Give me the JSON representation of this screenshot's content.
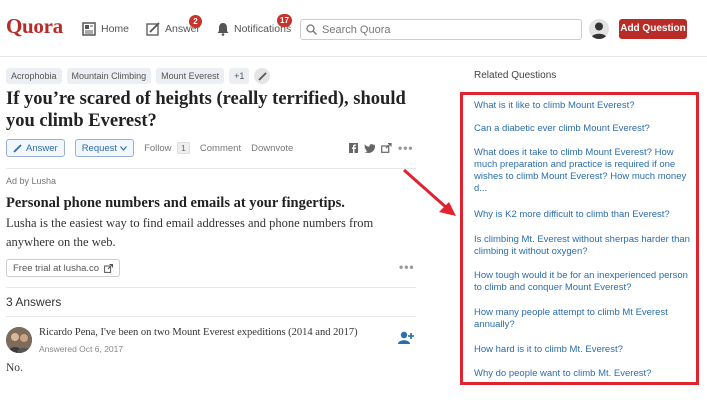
{
  "header": {
    "logo": "Quora",
    "nav": {
      "home": "Home",
      "answer": "Answer",
      "answer_badge": "2",
      "notifications": "Notifications",
      "notifications_badge": "17"
    },
    "search_placeholder": "Search Quora",
    "add_question": "Add Question"
  },
  "question": {
    "topics": [
      "Acrophobia",
      "Mountain Climbing",
      "Mount Everest",
      "+1"
    ],
    "title": "If you’re scared of heights (really terrified), should you climb Everest?",
    "actions": {
      "answer": "Answer",
      "request": "Request",
      "follow": "Follow",
      "follow_count": "1",
      "comment": "Comment",
      "downvote": "Downvote"
    }
  },
  "ad": {
    "label": "Ad by Lusha",
    "title": "Personal phone numbers and emails at your fingertips.",
    "body": "Lusha is the easiest way to find email addresses and phone numbers from anywhere on the web.",
    "button": "Free trial at lusha.co"
  },
  "answers": {
    "count_label": "3 Answers",
    "items": [
      {
        "author": "Ricardo Pena,",
        "credential": " I've been on two Mount Everest expeditions (2014 and 2017)",
        "date": "Answered Oct 6, 2017",
        "text": "No."
      }
    ]
  },
  "sidebar": {
    "title": "Related Questions",
    "questions": [
      "What is it like to climb Mount Everest?",
      "Can a diabetic ever climb Mount Everest?",
      "What does it take to climb Mount Everest? How much preparation and practice is required if one wishes to climb Mount Everest? How much money d...",
      "Why is K2 more difficult to climb than Everest?",
      "Is climbing Mt. Everest without sherpas harder than climbing it without oxygen?",
      "How tough would it be for an inexperienced person to climb and conquer Mount Everest?",
      "How many people attempt to climb Mt Everest annually?",
      "How hard is it to climb Mt. Everest?",
      "Why do people want to climb Mt. Everest?"
    ]
  },
  "colors": {
    "brand": "#b92b27",
    "link": "#2b6dad",
    "highlight": "#e0232e"
  }
}
